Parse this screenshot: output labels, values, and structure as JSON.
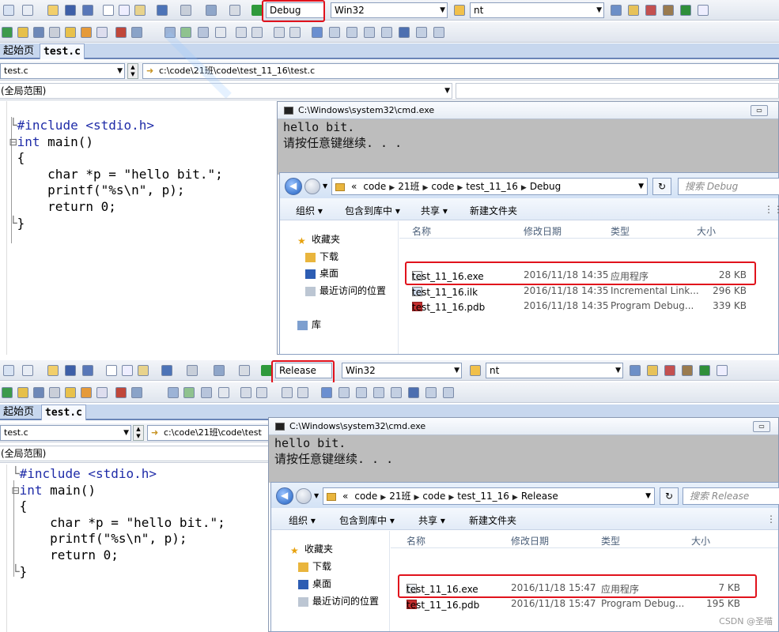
{
  "panels": [
    {
      "config": "Debug",
      "platform": "Win32",
      "find_text": "nt",
      "tabs": {
        "start_page": "起始页",
        "file": "test.c"
      },
      "file_combo": "test.c",
      "path": "c:\\code\\21班\\code\\test_11_16\\test.c",
      "scope": "(全局范围)",
      "code_lines": [
        {
          "fold": "└",
          "t1": "#include ",
          "t2": "<stdio.h>"
        },
        {
          "fold": "⊟",
          "kw": "int",
          "rest": " main()"
        },
        {
          "fold": " ",
          "rest": "{"
        },
        {
          "fold": " ",
          "rest": "    char *p = \"hello bit.\";"
        },
        {
          "fold": " ",
          "rest": "    printf(\"%s\\n\", p);"
        },
        {
          "fold": " ",
          "rest": "    return 0;"
        },
        {
          "fold": "└",
          "rest": "}"
        }
      ],
      "cmd_title": "C:\\Windows\\system32\\cmd.exe",
      "console_lines": [
        "hello bit.",
        "请按任意键继续. . ."
      ],
      "explorer": {
        "crumbs": [
          "«",
          "code",
          "21班",
          "code",
          "test_11_16",
          "Debug"
        ],
        "search_placeholder": "搜索 Debug",
        "commands": [
          "组织 ▾",
          "包含到库中 ▾",
          "共享 ▾",
          "新建文件夹"
        ],
        "nav": [
          "收藏夹",
          "下载",
          "桌面",
          "最近访问的位置",
          "库"
        ],
        "columns": [
          "名称",
          "修改日期",
          "类型",
          "大小"
        ],
        "files": [
          {
            "name": "test_11_16.exe",
            "date": "2016/11/18 14:35",
            "type": "应用程序",
            "size": "28 KB",
            "icon": "exe-icon"
          },
          {
            "name": "test_11_16.ilk",
            "date": "2016/11/18 14:35",
            "type": "Incremental Link...",
            "size": "296 KB",
            "icon": "ilk-icon"
          },
          {
            "name": "test_11_16.pdb",
            "date": "2016/11/18 14:35",
            "type": "Program Debug...",
            "size": "339 KB",
            "icon": "pdb-icon"
          }
        ]
      }
    },
    {
      "config": "Release",
      "platform": "Win32",
      "find_text": "nt",
      "tabs": {
        "start_page": "起始页",
        "file": "test.c"
      },
      "file_combo": "test.c",
      "path": "c:\\code\\21班\\code\\test",
      "scope": "(全局范围)",
      "code_lines": [
        {
          "fold": "└",
          "t1": "#include ",
          "t2": "<stdio.h>"
        },
        {
          "fold": "⊟",
          "kw": "int",
          "rest": " main()"
        },
        {
          "fold": " ",
          "rest": "{"
        },
        {
          "fold": " ",
          "rest": "    char *p = \"hello bit.\";"
        },
        {
          "fold": " ",
          "rest": "    printf(\"%s\\n\", p);"
        },
        {
          "fold": " ",
          "rest": "    return 0;"
        },
        {
          "fold": "└",
          "rest": "}"
        }
      ],
      "cmd_title": "C:\\Windows\\system32\\cmd.exe",
      "console_lines": [
        "hello bit.",
        "请按任意键继续. . ."
      ],
      "explorer": {
        "crumbs": [
          "«",
          "code",
          "21班",
          "code",
          "test_11_16",
          "Release"
        ],
        "search_placeholder": "搜索 Release",
        "commands": [
          "组织 ▾",
          "包含到库中 ▾",
          "共享 ▾",
          "新建文件夹"
        ],
        "nav": [
          "收藏夹",
          "下载",
          "桌面",
          "最近访问的位置"
        ],
        "columns": [
          "名称",
          "修改日期",
          "类型",
          "大小"
        ],
        "files": [
          {
            "name": "test_11_16.exe",
            "date": "2016/11/18 15:47",
            "type": "应用程序",
            "size": "7 KB",
            "icon": "exe-icon"
          },
          {
            "name": "test_11_16.pdb",
            "date": "2016/11/18 15:47",
            "type": "Program Debug...",
            "size": "195 KB",
            "icon": "pdb-icon"
          }
        ]
      }
    }
  ],
  "watermark": "CSDN @圣喵",
  "colors": {
    "highlight": "#e1121c",
    "keyword": "#1f2ca8",
    "console_bg": "#bdbdbd"
  }
}
